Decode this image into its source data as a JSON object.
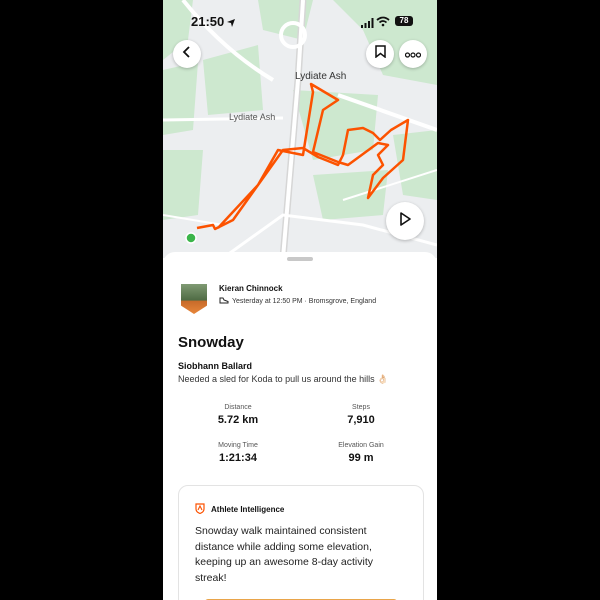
{
  "status_bar": {
    "time": "21:50",
    "battery": "78"
  },
  "map": {
    "labels": {
      "town_top": "Lydiate Ash",
      "town_left": "Lydiate Ash"
    },
    "route_color": "#fc5200",
    "start_color": "#3bb54a",
    "icons": {
      "back": "chevron-left-icon",
      "bookmark": "bookmark-icon",
      "more": "more-icon",
      "play": "play-icon"
    }
  },
  "activity": {
    "athlete_name": "Kieran Chinnock",
    "meta": "Yesterday at 12:50 PM · Bromsgrove, England",
    "title": "Snowday",
    "companion": "Siobhann Ballard",
    "description": "Needed a sled for Koda to pull us around the hills 👌🏻",
    "stats": {
      "distance_label": "Distance",
      "distance_value": "5.72 km",
      "steps_label": "Steps",
      "steps_value": "7,910",
      "moving_time_label": "Moving Time",
      "moving_time_value": "1:21:34",
      "elevation_label": "Elevation Gain",
      "elevation_value": "99 m"
    }
  },
  "athlete_intelligence": {
    "heading": "Athlete Intelligence",
    "text": "Snowday walk maintained consistent distance while adding some elevation, keeping up an awesome 8-day activity streak!"
  }
}
